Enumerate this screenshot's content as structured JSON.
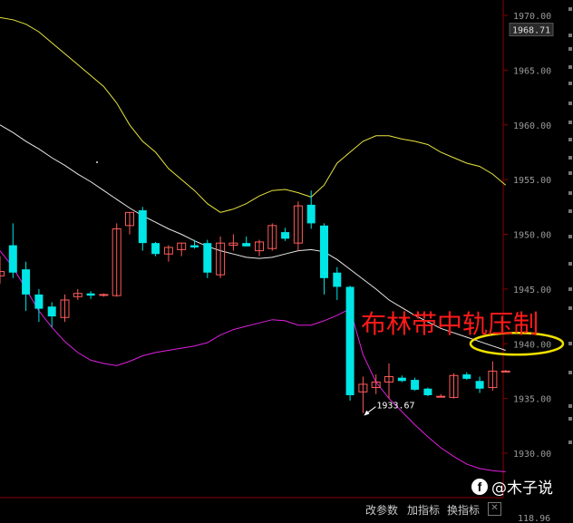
{
  "chart_data": {
    "type": "candlestick",
    "ylim": [
      1928.0,
      1970.5
    ],
    "y_ticks": [
      "1970.00",
      "1965.00",
      "1960.00",
      "1955.00",
      "1950.00",
      "1945.00",
      "1940.00",
      "1935.00",
      "1930.00"
    ],
    "y_tick_values": [
      1970,
      1965,
      1960,
      1955,
      1950,
      1945,
      1940,
      1935,
      1930
    ],
    "current_price_label": "1968.71",
    "current_price": 1968.71,
    "bottom_axis_label": "118.96",
    "low_annotation": {
      "text": "1933.67",
      "value": 1933.67,
      "candle_index": 28
    },
    "candles": [
      {
        "o": 1946.2,
        "h": 1948.0,
        "l": 1945.5,
        "c": 1946.6
      },
      {
        "o": 1949.0,
        "h": 1951.0,
        "l": 1946.0,
        "c": 1946.5
      },
      {
        "o": 1946.8,
        "h": 1947.5,
        "l": 1943.0,
        "c": 1944.5
      },
      {
        "o": 1944.5,
        "h": 1945.0,
        "l": 1942.0,
        "c": 1943.2
      },
      {
        "o": 1943.4,
        "h": 1943.8,
        "l": 1941.5,
        "c": 1942.5
      },
      {
        "o": 1942.4,
        "h": 1944.5,
        "l": 1942.0,
        "c": 1944.0
      },
      {
        "o": 1944.3,
        "h": 1945.0,
        "l": 1944.0,
        "c": 1944.6
      },
      {
        "o": 1944.6,
        "h": 1944.8,
        "l": 1944.1,
        "c": 1944.4
      },
      {
        "o": 1944.5,
        "h": 1944.6,
        "l": 1944.3,
        "c": 1944.5
      },
      {
        "o": 1944.4,
        "h": 1951.0,
        "l": 1944.3,
        "c": 1950.5
      },
      {
        "o": 1950.8,
        "h": 1952.0,
        "l": 1950.0,
        "c": 1952.0
      },
      {
        "o": 1952.2,
        "h": 1952.5,
        "l": 1948.5,
        "c": 1949.2
      },
      {
        "o": 1949.2,
        "h": 1949.3,
        "l": 1948.0,
        "c": 1948.2
      },
      {
        "o": 1948.2,
        "h": 1949.0,
        "l": 1947.5,
        "c": 1948.8
      },
      {
        "o": 1948.6,
        "h": 1949.2,
        "l": 1948.0,
        "c": 1949.2
      },
      {
        "o": 1949.0,
        "h": 1949.5,
        "l": 1948.7,
        "c": 1948.8
      },
      {
        "o": 1949.2,
        "h": 1949.5,
        "l": 1946.0,
        "c": 1946.5
      },
      {
        "o": 1946.3,
        "h": 1949.8,
        "l": 1946.0,
        "c": 1949.2
      },
      {
        "o": 1949.0,
        "h": 1950.0,
        "l": 1948.5,
        "c": 1949.2
      },
      {
        "o": 1949.2,
        "h": 1949.8,
        "l": 1948.9,
        "c": 1948.9
      },
      {
        "o": 1948.5,
        "h": 1949.5,
        "l": 1948.0,
        "c": 1949.3
      },
      {
        "o": 1948.7,
        "h": 1951.0,
        "l": 1948.5,
        "c": 1950.8
      },
      {
        "o": 1950.2,
        "h": 1950.6,
        "l": 1949.4,
        "c": 1949.6
      },
      {
        "o": 1949.2,
        "h": 1953.0,
        "l": 1948.5,
        "c": 1952.6
      },
      {
        "o": 1952.7,
        "h": 1954.0,
        "l": 1950.5,
        "c": 1951.0
      },
      {
        "o": 1950.8,
        "h": 1951.0,
        "l": 1944.5,
        "c": 1946.0
      },
      {
        "o": 1946.5,
        "h": 1947.0,
        "l": 1944.0,
        "c": 1945.2
      },
      {
        "o": 1945.2,
        "h": 1945.3,
        "l": 1934.8,
        "c": 1935.3
      },
      {
        "o": 1935.6,
        "h": 1937.0,
        "l": 1933.67,
        "c": 1936.3
      },
      {
        "o": 1936.0,
        "h": 1937.2,
        "l": 1935.4,
        "c": 1936.5
      },
      {
        "o": 1936.5,
        "h": 1938.2,
        "l": 1935.0,
        "c": 1937.0
      },
      {
        "o": 1936.9,
        "h": 1937.1,
        "l": 1936.5,
        "c": 1936.6
      },
      {
        "o": 1936.7,
        "h": 1936.9,
        "l": 1935.7,
        "c": 1935.8
      },
      {
        "o": 1935.9,
        "h": 1936.0,
        "l": 1935.2,
        "c": 1935.3
      },
      {
        "o": 1935.2,
        "h": 1935.4,
        "l": 1935.1,
        "c": 1935.2
      },
      {
        "o": 1935.1,
        "h": 1937.3,
        "l": 1935.0,
        "c": 1937.1
      },
      {
        "o": 1937.2,
        "h": 1937.4,
        "l": 1936.7,
        "c": 1936.8
      },
      {
        "o": 1936.6,
        "h": 1937.0,
        "l": 1935.5,
        "c": 1935.9
      },
      {
        "o": 1936.0,
        "h": 1938.4,
        "l": 1935.7,
        "c": 1937.5
      },
      {
        "o": 1937.5,
        "h": 1937.6,
        "l": 1937.4,
        "c": 1937.5
      }
    ],
    "bollinger": {
      "upper": [
        1969.8,
        1969.6,
        1969.2,
        1968.5,
        1967.5,
        1966.5,
        1965.5,
        1964.5,
        1963.5,
        1962.0,
        1960.0,
        1958.5,
        1957.5,
        1956.0,
        1955.0,
        1954.0,
        1952.8,
        1952.0,
        1952.3,
        1952.8,
        1953.5,
        1954.0,
        1954.1,
        1953.8,
        1953.4,
        1954.5,
        1956.5,
        1957.5,
        1958.5,
        1959.0,
        1959.0,
        1958.7,
        1958.5,
        1958.2,
        1957.5,
        1957.0,
        1956.5,
        1956.2,
        1955.5,
        1954.5
      ],
      "middle": [
        1960.0,
        1959.3,
        1958.5,
        1957.8,
        1957.0,
        1956.3,
        1955.5,
        1954.8,
        1954.0,
        1953.2,
        1952.4,
        1951.7,
        1951.1,
        1950.5,
        1950.0,
        1949.4,
        1948.9,
        1948.5,
        1948.2,
        1947.9,
        1947.8,
        1947.9,
        1948.2,
        1948.5,
        1948.6,
        1948.4,
        1947.7,
        1946.8,
        1945.9,
        1945.0,
        1944.0,
        1943.3,
        1942.6,
        1942.0,
        1941.4,
        1941.0,
        1940.6,
        1940.2,
        1939.8,
        1939.4
      ],
      "lower": [
        1948.5,
        1947.0,
        1945.0,
        1943.0,
        1941.5,
        1940.2,
        1939.2,
        1938.5,
        1938.2,
        1938.0,
        1938.4,
        1938.9,
        1939.2,
        1939.4,
        1939.6,
        1939.8,
        1940.1,
        1940.8,
        1941.3,
        1941.6,
        1941.9,
        1942.2,
        1942.1,
        1941.7,
        1941.7,
        1942.1,
        1942.6,
        1943.2,
        1939.0,
        1936.5,
        1935.0,
        1933.8,
        1932.6,
        1931.5,
        1930.5,
        1929.7,
        1929.0,
        1928.6,
        1928.4,
        1928.3
      ]
    },
    "colors": {
      "up": "#ff5a5a",
      "down": "#00e5e5",
      "upper": "#e8e440",
      "middle": "#e8e8e8",
      "lower": "#e020e0"
    }
  },
  "annotation_text": "布林带中轨压制",
  "bottom_bar": {
    "btn1": "改参数",
    "btn2": "加指标",
    "btn3": "换指标",
    "close": "✕"
  },
  "watermark": {
    "icon": "f",
    "text": "@木子说"
  }
}
